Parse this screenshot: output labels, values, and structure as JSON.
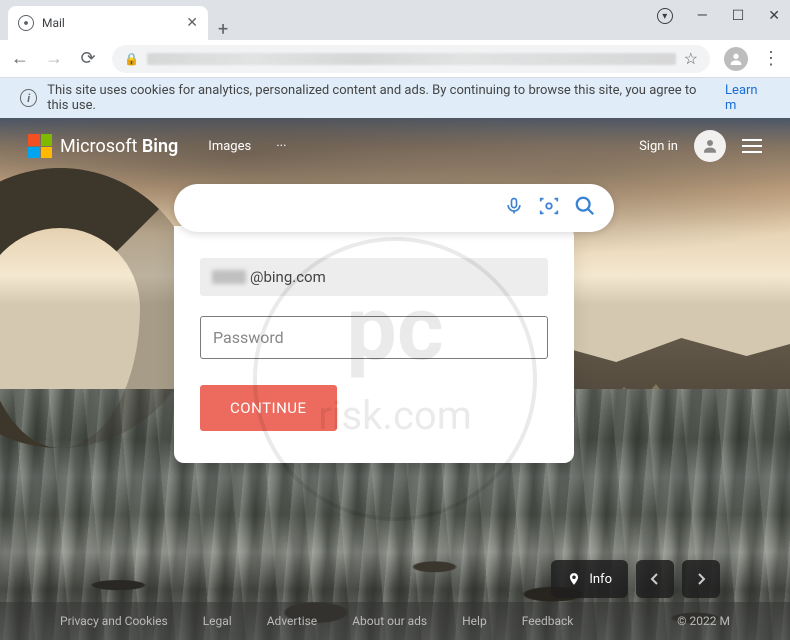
{
  "browser": {
    "tab_title": "Mail",
    "window_controls": {
      "minimize": "—",
      "maximize": "☐",
      "close": "✕"
    }
  },
  "cookie_banner": {
    "text": "This site uses cookies for analytics, personalized content and ads. By continuing to browse this site, you agree to this use.",
    "link": "Learn m"
  },
  "bing": {
    "logo_text_a": "Microsoft ",
    "logo_text_b": "Bing",
    "nav_images": "Images",
    "nav_more": "···",
    "sign_in": "Sign in"
  },
  "login": {
    "email_suffix": "@bing.com",
    "password_placeholder": "Password",
    "continue_label": "CONTINUE"
  },
  "info_button": "Info",
  "footer": {
    "privacy": "Privacy and Cookies",
    "legal": "Legal",
    "advertise": "Advertise",
    "about": "About our ads",
    "help": "Help",
    "feedback": "Feedback",
    "copyright": "© 2022 M"
  },
  "colors": {
    "accent_red": "#ed6a5e",
    "bing_blue": "#3b82d4"
  }
}
